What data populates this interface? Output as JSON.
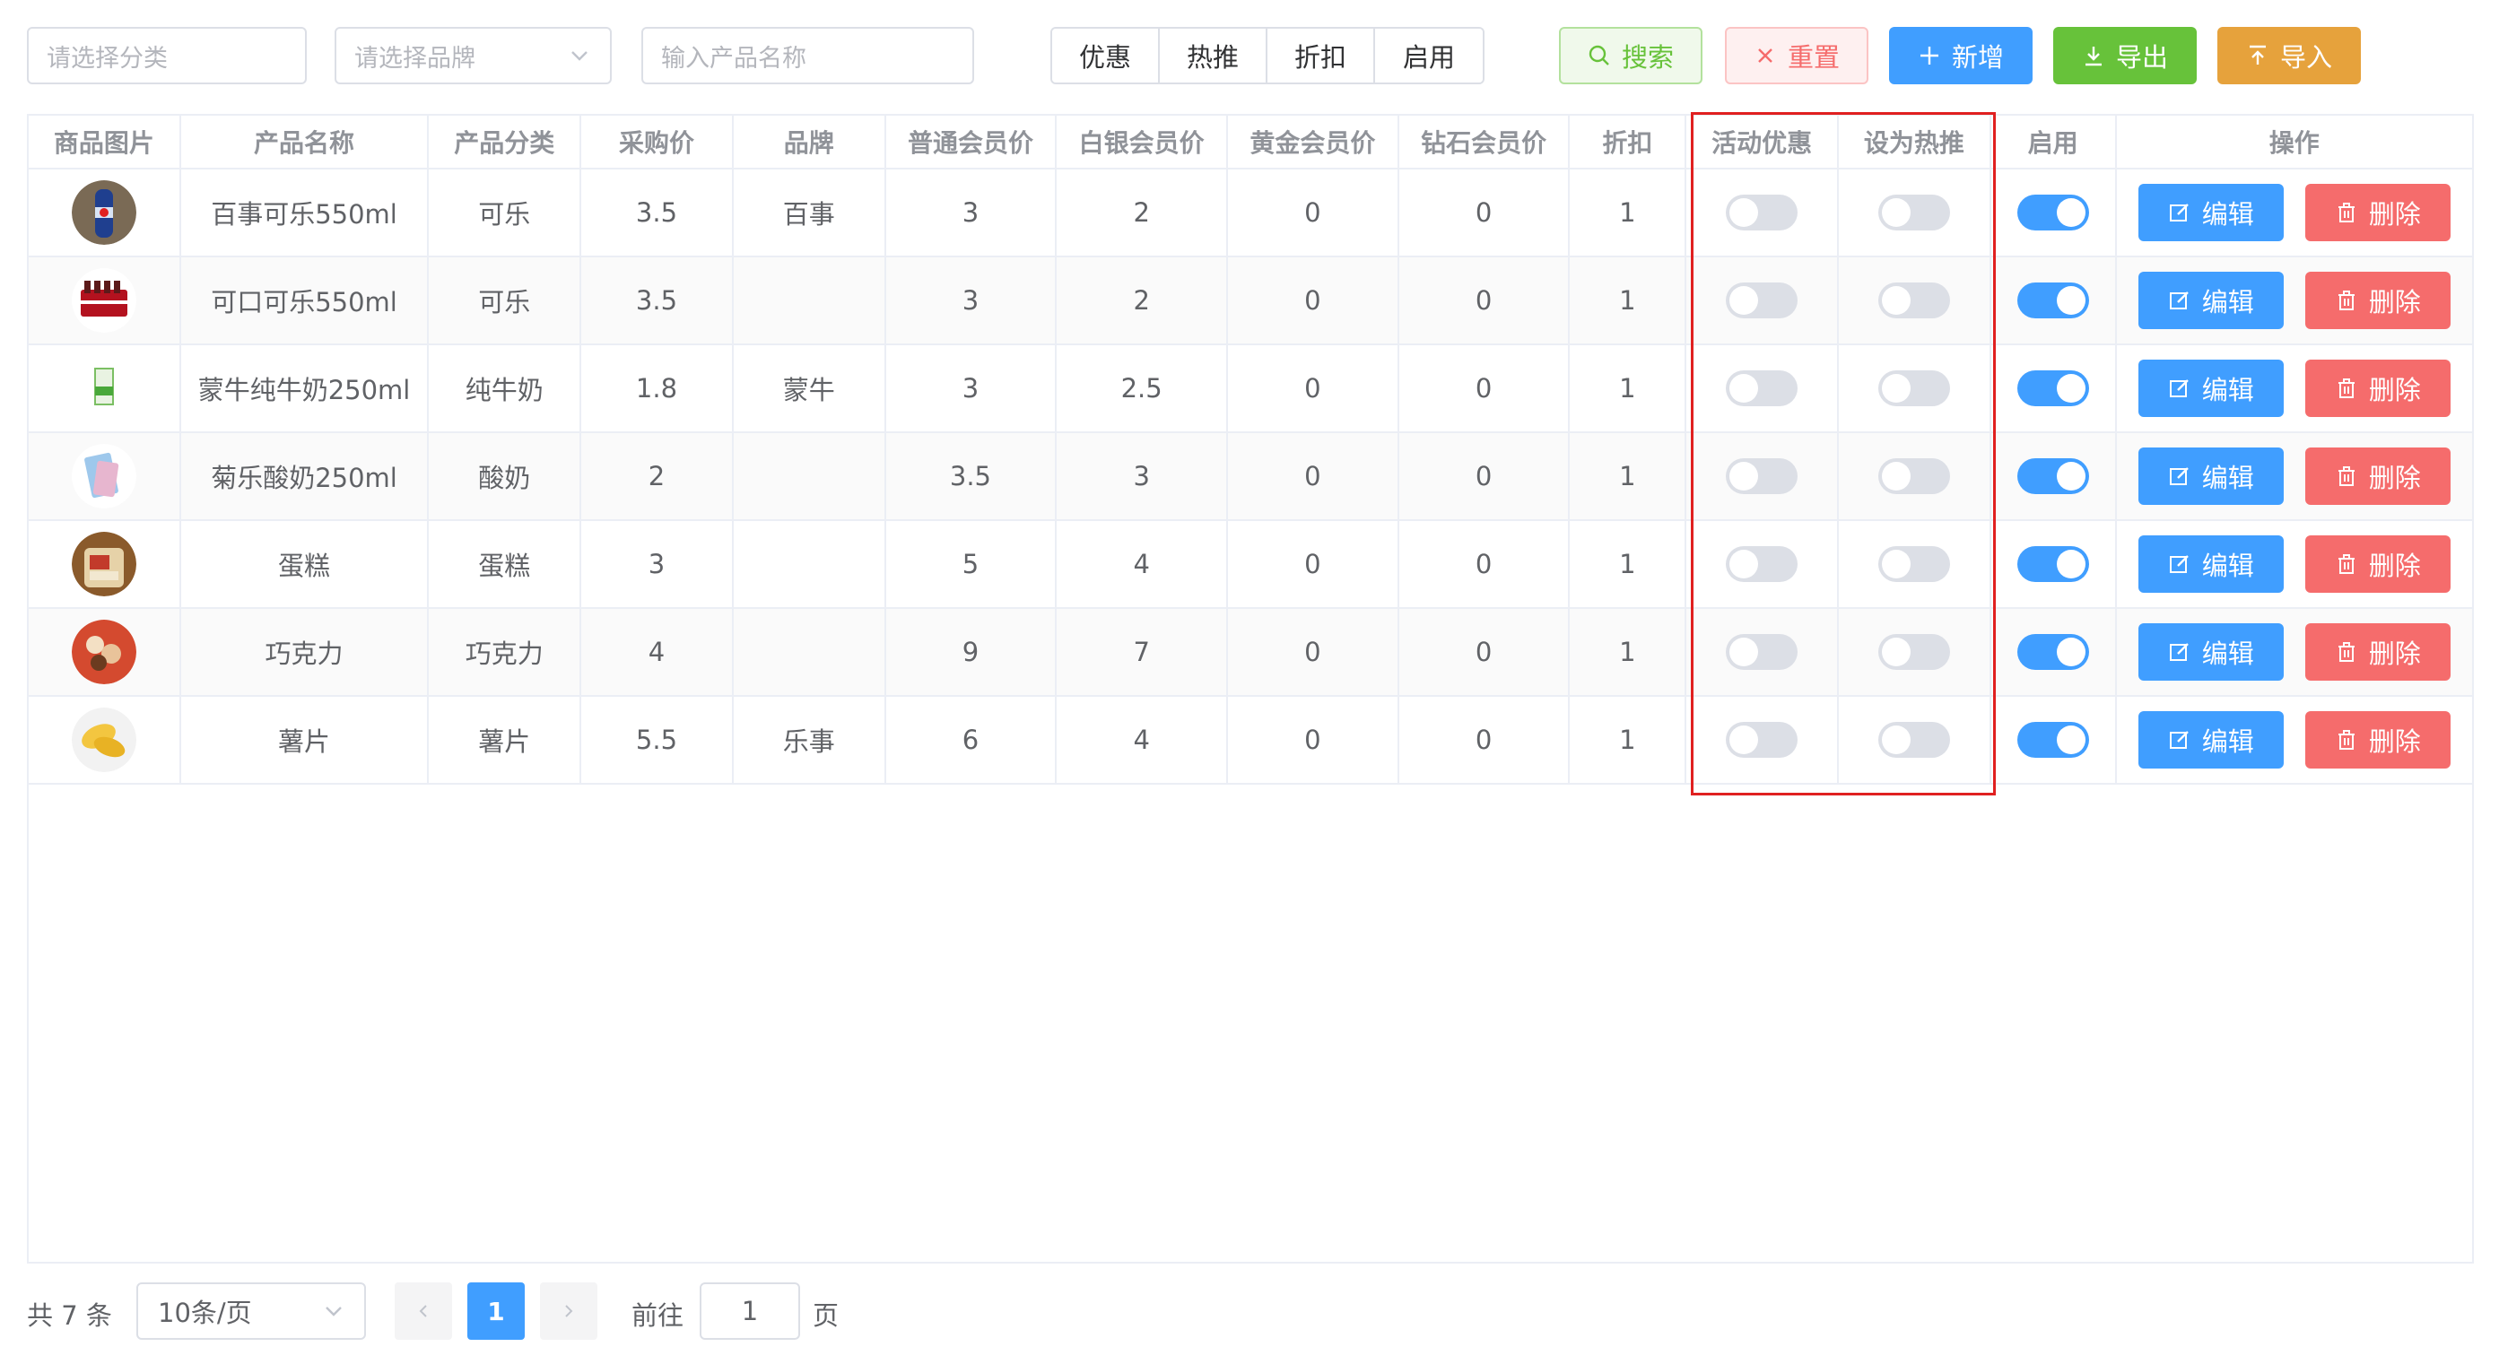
{
  "toolbar": {
    "category_placeholder": "请选择分类",
    "brand_placeholder": "请选择品牌",
    "name_placeholder": "输入产品名称",
    "filters": [
      "优惠",
      "热推",
      "折扣",
      "启用"
    ],
    "search": "搜索",
    "reset": "重置",
    "add": "新增",
    "export": "导出",
    "import": "导入"
  },
  "table": {
    "columns": [
      "商品图片",
      "产品名称",
      "产品分类",
      "采购价",
      "品牌",
      "普通会员价",
      "白银会员价",
      "黄金会员价",
      "钻石会员价",
      "折扣",
      "活动优惠",
      "设为热推",
      "启用",
      "操作"
    ],
    "edit_label": "编辑",
    "delete_label": "删除",
    "rows": [
      {
        "thumb": "cola-bottle",
        "name": "百事可乐550ml",
        "category": "可乐",
        "purchase": "3.5",
        "brand": "百事",
        "normal": "3",
        "silver": "2",
        "gold": "0",
        "diamond": "0",
        "discount": "1",
        "promo": false,
        "hot": false,
        "enabled": true
      },
      {
        "thumb": "coke-pack",
        "name": "可口可乐550ml",
        "category": "可乐",
        "purchase": "3.5",
        "brand": "",
        "normal": "3",
        "silver": "2",
        "gold": "0",
        "diamond": "0",
        "discount": "1",
        "promo": false,
        "hot": false,
        "enabled": true
      },
      {
        "thumb": "milk-carton",
        "name": "蒙牛纯牛奶250ml",
        "category": "纯牛奶",
        "purchase": "1.8",
        "brand": "蒙牛",
        "normal": "3",
        "silver": "2.5",
        "gold": "0",
        "diamond": "0",
        "discount": "1",
        "promo": false,
        "hot": false,
        "enabled": true
      },
      {
        "thumb": "yogurt-box",
        "name": "菊乐酸奶250ml",
        "category": "酸奶",
        "purchase": "2",
        "brand": "",
        "normal": "3.5",
        "silver": "3",
        "gold": "0",
        "diamond": "0",
        "discount": "1",
        "promo": false,
        "hot": false,
        "enabled": true
      },
      {
        "thumb": "cake",
        "name": "蛋糕",
        "category": "蛋糕",
        "purchase": "3",
        "brand": "",
        "normal": "5",
        "silver": "4",
        "gold": "0",
        "diamond": "0",
        "discount": "1",
        "promo": false,
        "hot": false,
        "enabled": true
      },
      {
        "thumb": "chocolate",
        "name": "巧克力",
        "category": "巧克力",
        "purchase": "4",
        "brand": "",
        "normal": "9",
        "silver": "7",
        "gold": "0",
        "diamond": "0",
        "discount": "1",
        "promo": false,
        "hot": false,
        "enabled": true
      },
      {
        "thumb": "chips",
        "name": "薯片",
        "category": "薯片",
        "purchase": "5.5",
        "brand": "乐事",
        "normal": "6",
        "silver": "4",
        "gold": "0",
        "diamond": "0",
        "discount": "1",
        "promo": false,
        "hot": false,
        "enabled": true
      }
    ]
  },
  "pagination": {
    "total_text": "共 7 条",
    "page_size": "10条/页",
    "current_page": "1",
    "goto_label": "前往",
    "goto_value": "1",
    "unit_label": "页"
  },
  "colors": {
    "primary": "#409eff",
    "success": "#67c23a",
    "danger": "#f56c6c",
    "warning": "#e6a23c",
    "highlight": "#e02020"
  }
}
